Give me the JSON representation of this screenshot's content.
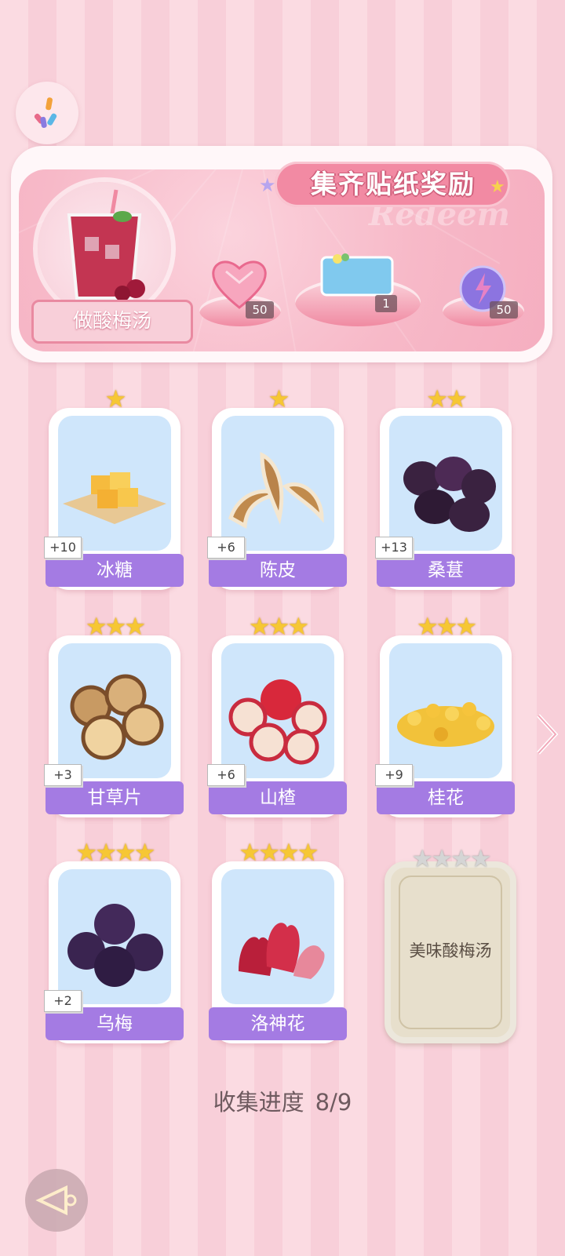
{
  "banner": {
    "title": "集齐贴纸奖励",
    "watermark": "Redeem",
    "drink_label": "做酸梅汤",
    "rewards": [
      {
        "icon": "heart-gem-icon",
        "count": "50"
      },
      {
        "icon": "blue-ticket-icon",
        "count": "1"
      },
      {
        "icon": "lightning-orb-icon",
        "count": "50"
      }
    ]
  },
  "stickers": [
    {
      "name": "冰糖",
      "stars": "★",
      "bonus": "+10"
    },
    {
      "name": "陈皮",
      "stars": "★",
      "bonus": "+6"
    },
    {
      "name": "桑葚",
      "stars": "★★",
      "bonus": "+13"
    },
    {
      "name": "甘草片",
      "stars": "★★★",
      "bonus": "+3"
    },
    {
      "name": "山楂",
      "stars": "★★★",
      "bonus": "+6"
    },
    {
      "name": "桂花",
      "stars": "★★★",
      "bonus": "+9"
    },
    {
      "name": "乌梅",
      "stars": "★★★★",
      "bonus": "+2"
    },
    {
      "name": "洛神花",
      "stars": "★★★★",
      "bonus": ""
    },
    {
      "name": "美味酸梅汤",
      "stars": "★★★★",
      "locked": true
    }
  ],
  "progress": {
    "label": "收集进度",
    "value": "8/9"
  },
  "colors": {
    "accent_pink": "#f28aa3",
    "label_purple": "#a47be3",
    "card_blue": "#cfe6fb",
    "star_gold": "#f6c734"
  }
}
